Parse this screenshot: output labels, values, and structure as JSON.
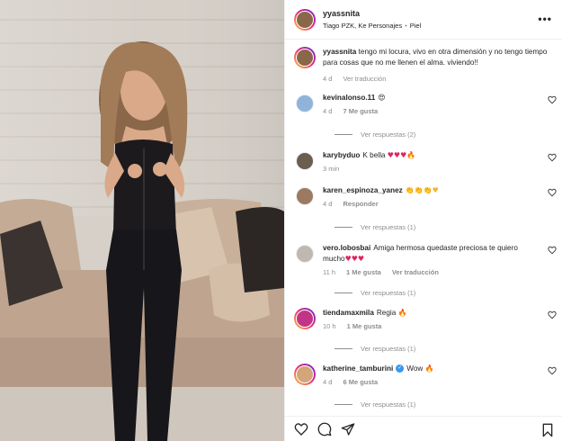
{
  "post": {
    "username": "yyassnita",
    "audio": "Tiago PZK, Ke Personajes",
    "separator": "•",
    "filter": "Piel",
    "more_icon": "more-horizontal-icon"
  },
  "caption": {
    "username": "yyassnita",
    "text": "tengo mi locura, vivo en otra dimensión y no tengo tiempo para cosas que no me llenen el alma. viviendo!!",
    "time": "4 d",
    "translate": "Ver traducción"
  },
  "comments": [
    {
      "username": "kevinalonso.11",
      "text": "",
      "emoji": "😍",
      "time": "4 d",
      "likes": "7 Me gusta",
      "reply": "",
      "translate": "",
      "replies": "Ver respuestas (2)",
      "avatar_color": "#8fb3d9"
    },
    {
      "username": "karybyduo",
      "text": "K bella",
      "emoji": "♥♥♥🔥",
      "time": "3 min",
      "likes": "",
      "reply": "",
      "translate": "",
      "replies": "",
      "avatar_color": "#6b5d4f"
    },
    {
      "username": "karen_espinoza_yanez",
      "text": "",
      "emoji": "👏👏👏♥",
      "time": "4 d",
      "likes": "",
      "reply": "Responder",
      "translate": "",
      "replies": "Ver respuestas (1)",
      "avatar_color": "#9c7a61"
    },
    {
      "username": "vero.lobosbai",
      "text": "Amiga hermosa quedaste preciosa te quiero mucho",
      "emoji": "♥♥♥",
      "time": "11 h",
      "likes": "1 Me gusta",
      "reply": "",
      "translate": "Ver traducción",
      "replies": "Ver respuestas (1)",
      "avatar_color": "#bfb8b0"
    },
    {
      "username": "tiendamaxmila",
      "text": "Regia",
      "emoji": "🔥",
      "time": "10 h",
      "likes": "1 Me gusta",
      "reply": "",
      "translate": "",
      "replies": "Ver respuestas (1)",
      "avatar_color": "#c13584"
    },
    {
      "username": "katherine_tamburini",
      "verified": "✓",
      "text": "Wow",
      "emoji": "🔥",
      "time": "4 d",
      "likes": "6 Me gusta",
      "reply": "",
      "translate": "",
      "replies": "Ver respuestas (1)",
      "avatar_color": "#d2a679"
    }
  ],
  "actions": {
    "like_icon": "heart-icon",
    "comment_icon": "comment-icon",
    "share_icon": "share-icon",
    "save_icon": "bookmark-icon"
  }
}
